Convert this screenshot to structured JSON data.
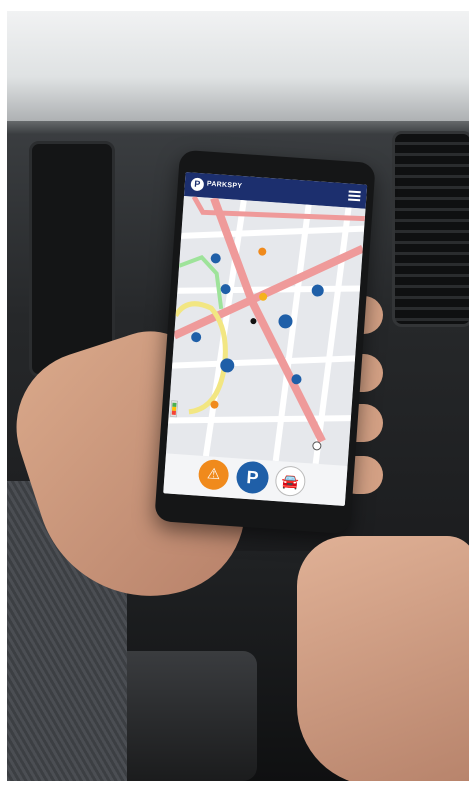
{
  "app": {
    "brand_name": "PARKSPY",
    "logo_letter": "P",
    "accent_color": "#1c2f6e",
    "alert_color": "#f08a1c",
    "parking_color": "#1f5fa8"
  },
  "map": {
    "parking_marker_label": "P",
    "marker_count": 8
  },
  "bottom_bar": {
    "alert_button_icon": "⚠",
    "parking_button_label": "P",
    "car_button_icon": "🚘"
  }
}
